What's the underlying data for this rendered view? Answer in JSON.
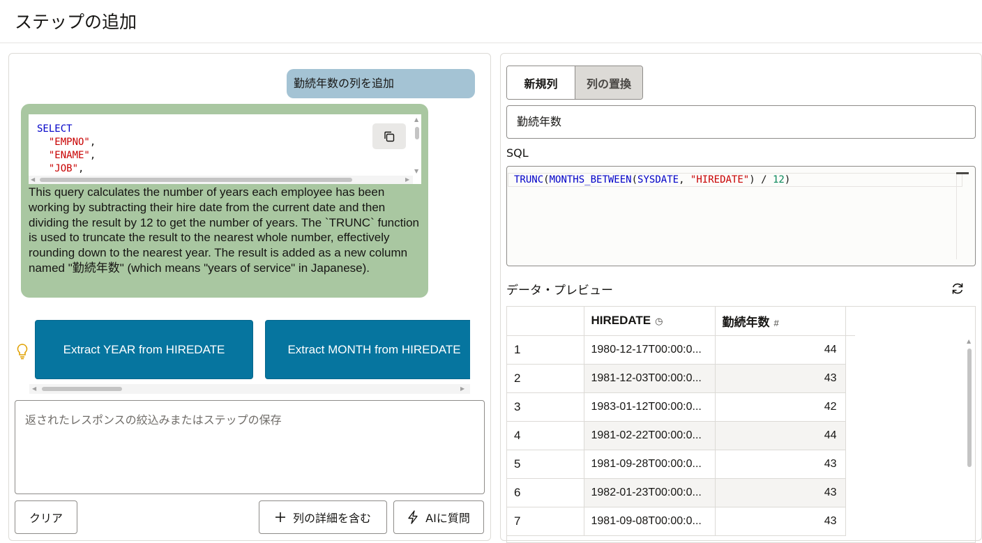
{
  "page": {
    "title": "ステップの追加"
  },
  "chat": {
    "user_message": "勤続年数の列を追加",
    "code_lines": [
      {
        "kw": "SELECT"
      },
      {
        "str": "\"EMPNO\"",
        "punct": ","
      },
      {
        "str": "\"ENAME\"",
        "punct": ","
      },
      {
        "str": "\"JOB\"",
        "punct": ","
      }
    ],
    "explanation": "This query calculates the number of years each employee has been working by subtracting their hire date from the current date and then dividing the result by 12 to get the number of years. The `TRUNC` function is used to truncate the result to the nearest whole number, effectively rounding down to the nearest year. The result is added as a new column named \"勤続年数\" (which means \"years of service\" in Japanese).",
    "copy_icon": "copy-icon"
  },
  "suggestions": [
    "Extract YEAR from HIREDATE",
    "Extract MONTH from HIREDATE"
  ],
  "prompt": {
    "placeholder": "返されたレスポンスの絞込みまたはステップの保存"
  },
  "actions": {
    "clear": "クリア",
    "include_details": "列の詳細を含む",
    "ask_ai": "AIに質問"
  },
  "editor": {
    "mode_new": "新規列",
    "mode_replace": "列の置換",
    "column_name": "勤続年数",
    "sql_label": "SQL",
    "sql": {
      "fn1": "TRUNC",
      "p1": "(",
      "fn2": "MONTHS_BETWEEN",
      "p2": "(",
      "fn3": "SYSDATE",
      "comma": ", ",
      "str": "\"HIREDATE\"",
      "p3": ")",
      "div": " / ",
      "num": "12",
      "p4": ")"
    }
  },
  "preview": {
    "label": "データ・プレビュー",
    "columns": [
      {
        "name": "HIREDATE",
        "icon": "◷"
      },
      {
        "name": "勤続年数",
        "icon": "#"
      }
    ],
    "rows": [
      {
        "n": "1",
        "hiredate": "1980-12-17T00:00:0...",
        "years": "44"
      },
      {
        "n": "2",
        "hiredate": "1981-12-03T00:00:0...",
        "years": "43"
      },
      {
        "n": "3",
        "hiredate": "1983-01-12T00:00:0...",
        "years": "42"
      },
      {
        "n": "4",
        "hiredate": "1981-02-22T00:00:0...",
        "years": "44"
      },
      {
        "n": "5",
        "hiredate": "1981-09-28T00:00:0...",
        "years": "43"
      },
      {
        "n": "6",
        "hiredate": "1982-01-23T00:00:0...",
        "years": "43"
      },
      {
        "n": "7",
        "hiredate": "1981-09-08T00:00:0...",
        "years": "43"
      }
    ]
  },
  "colors": {
    "suggestion_bg": "#06759f",
    "user_bubble": "#a4c3d4",
    "ai_bubble": "#a9c7a1"
  }
}
